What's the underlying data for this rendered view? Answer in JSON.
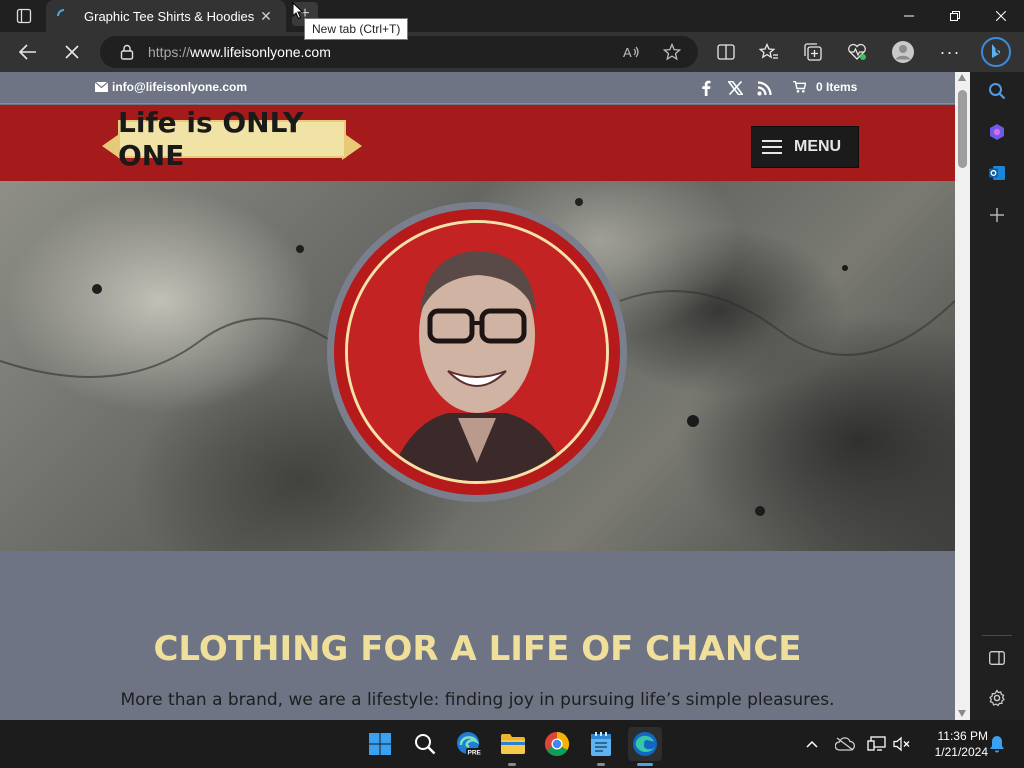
{
  "browser": {
    "tab_title": "Graphic Tee Shirts & Hoodies",
    "new_tab_tooltip": "New tab (Ctrl+T)",
    "url_protocol": "https://",
    "url_host": "www.lifeisonlyone.com"
  },
  "site": {
    "email": "info@lifeisonlyone.com",
    "cart_label": "0 Items",
    "logo_text": "Life is ONLY ONE",
    "menu_label": "MENU",
    "headline": "CLOTHING FOR A LIFE OF CHANCE",
    "tagline": "More than a brand, we are a lifestyle: finding joy in pursuing life’s simple pleasures."
  },
  "taskbar": {
    "time": "11:36 PM",
    "date": "1/21/2024"
  },
  "colors": {
    "header_red": "#a51a1a",
    "headline_cream": "#efdf9a",
    "page_slate": "#6e7483"
  }
}
